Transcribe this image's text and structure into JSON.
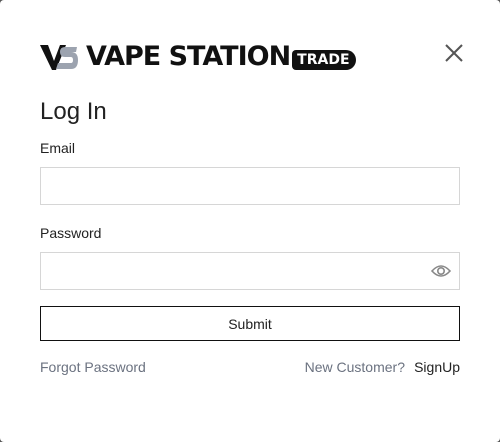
{
  "brand": {
    "name": "VAPE STATION",
    "badge": "TRADE",
    "mark_icon": "vs-logo-mark"
  },
  "modal": {
    "title": "Log In",
    "close_icon": "close-icon"
  },
  "form": {
    "email_label": "Email",
    "email_value": "",
    "password_label": "Password",
    "password_value": "",
    "show_password_icon": "eye-icon",
    "submit_label": "Submit"
  },
  "footer": {
    "forgot_password": "Forgot Password",
    "new_customer": "New Customer?",
    "signup": "SignUp"
  },
  "colors": {
    "text": "#222222",
    "muted": "#6b7280",
    "border": "#d6d6d6",
    "overlay": "#555555"
  }
}
